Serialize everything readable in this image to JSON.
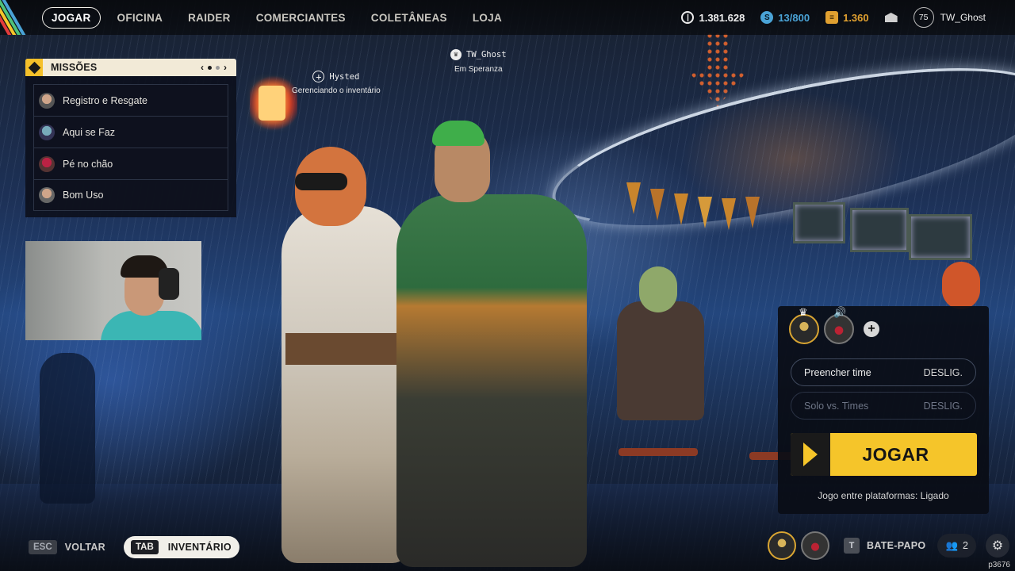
{
  "top_nav": {
    "items": [
      "JOGAR",
      "OFICINA",
      "RAIDER",
      "COMERCIANTES",
      "COLETÂNEAS",
      "LOJA"
    ],
    "active": "JOGAR"
  },
  "currencies": {
    "coins": "1.381.628",
    "blue": "13/800",
    "gold": "1.360"
  },
  "player": {
    "level": "75",
    "name": "TW_Ghost"
  },
  "missions": {
    "title": "MISSÕES",
    "items": [
      {
        "label": "Registro e Resgate"
      },
      {
        "label": "Aqui se Faz"
      },
      {
        "label": "Pé no chão"
      },
      {
        "label": "Bom Uso"
      }
    ]
  },
  "player_tags": {
    "main": {
      "name": "TW_Ghost",
      "status": "Em Speranza"
    },
    "ally": {
      "name": "Hysted",
      "status": "Gerenciando o inventário"
    }
  },
  "play_panel": {
    "fill_team": {
      "label": "Preencher time",
      "value": "DESLIG."
    },
    "solo_vs_teams": {
      "label": "Solo vs. Times",
      "value": "DESLIG."
    },
    "play_label": "JOGAR",
    "crossplay": "Jogo entre plataformas: Ligado"
  },
  "bottom": {
    "esc_key": "ESC",
    "back_label": "VOLTAR",
    "tab_key": "TAB",
    "inventory_label": "INVENTÁRIO",
    "chat_key": "T",
    "chat_label": "BATE-PAPO",
    "friends_count": "2"
  },
  "build_id": "p3676",
  "colors": {
    "accent_yellow": "#f5c52a",
    "panel_bg": "#0a0d16",
    "blue_currency": "#4aa3d6",
    "gold_currency": "#e0a030"
  }
}
